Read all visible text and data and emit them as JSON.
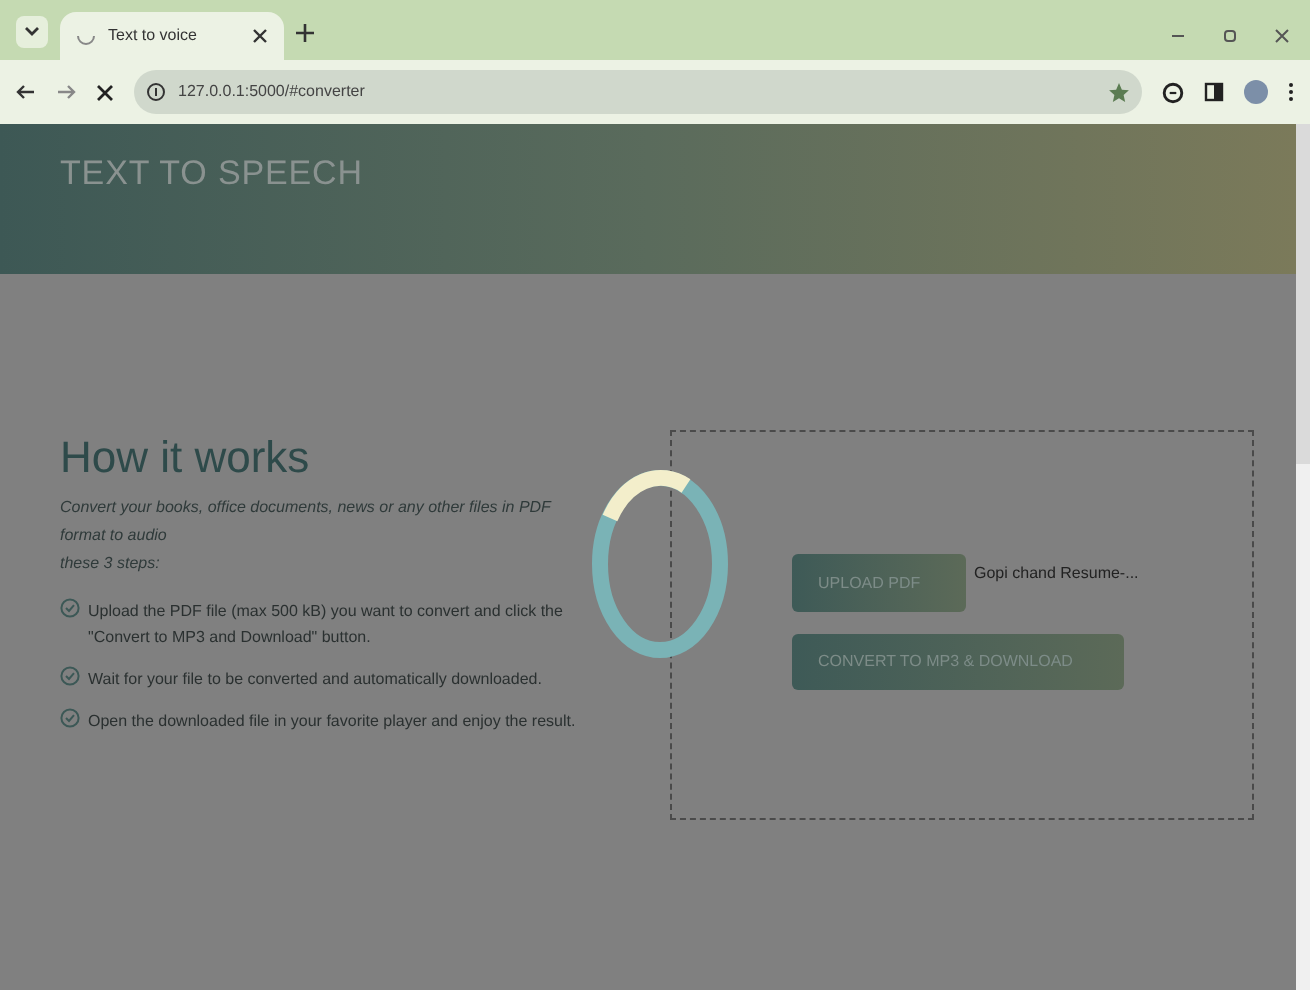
{
  "browser": {
    "tab_title": "Text to voice",
    "url": "127.0.0.1:5000/#converter"
  },
  "header": {
    "title": "TEXT TO SPEECH"
  },
  "how_it_works": {
    "heading": "How it works",
    "intro": "Convert your books, office documents, news or any other files in PDF format to audio",
    "intro_end": "these 3 steps:",
    "steps": [
      "Upload the PDF file (max 500 kB) you want to convert and click the \"Convert to MP3 and Download\" button.",
      "Wait for your file to be converted and automatically downloaded.",
      "Open the downloaded file in your favorite player and enjoy the result."
    ]
  },
  "converter": {
    "upload_button": "UPLOAD PDF",
    "file_name": "Gopi chand Resume-...",
    "convert_button": "CONVERT TO MP3 & DOWNLOAD"
  }
}
